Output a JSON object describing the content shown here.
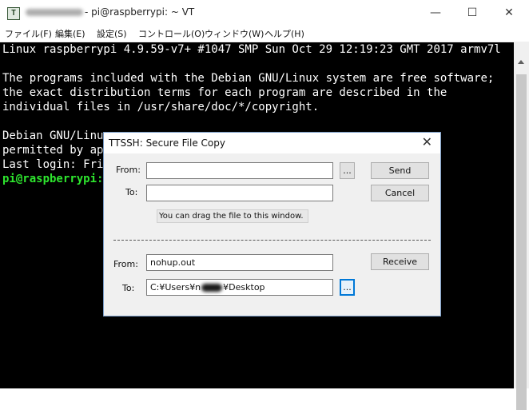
{
  "window": {
    "title": "pi@raspberrypi: ~ VT",
    "title_prefix": "- ",
    "icon_glyph": "T",
    "controls": {
      "minimize": "—",
      "maximize": "☐",
      "close": "✕"
    }
  },
  "menu": [
    "ファイル(F)",
    "編集(E)",
    "設定(S)",
    "コントロール(O)",
    "ウィンドウ(W)",
    "ヘルプ(H)"
  ],
  "terminal": {
    "lines": [
      "Linux raspberrypi 4.9.59-v7+ #1047 SMP Sun Oct 29 12:19:23 GMT 2017 armv7l",
      "",
      "The programs included with the Debian GNU/Linux system are free software;",
      "the exact distribution terms for each program are described in the",
      "individual files in /usr/share/doc/*/copyright.",
      "",
      "Debian GNU/Linux",
      "permitted by app",
      "Last login: Fri",
      "pi@raspberrypi:~"
    ],
    "prompt_color": "#2ee62e"
  },
  "dialog": {
    "title": "TTSSH: Secure File Copy",
    "close": "✕",
    "send": {
      "from_label": "From:",
      "from_value": "",
      "to_label": "To:",
      "to_value": "",
      "browse": "...",
      "send_button": "Send",
      "cancel_button": "Cancel",
      "hint": "You can drag the file to this window."
    },
    "receive": {
      "from_label": "From:",
      "from_value": "nohup.out",
      "to_label": "To:",
      "to_value_prefix": "C:¥Users¥n",
      "to_value_suffix": "¥Desktop",
      "browse": "...",
      "receive_button": "Receive"
    }
  },
  "colors": {
    "terminal_bg": "#000000",
    "terminal_fg": "#ffffff",
    "accent": "#0078d7"
  }
}
